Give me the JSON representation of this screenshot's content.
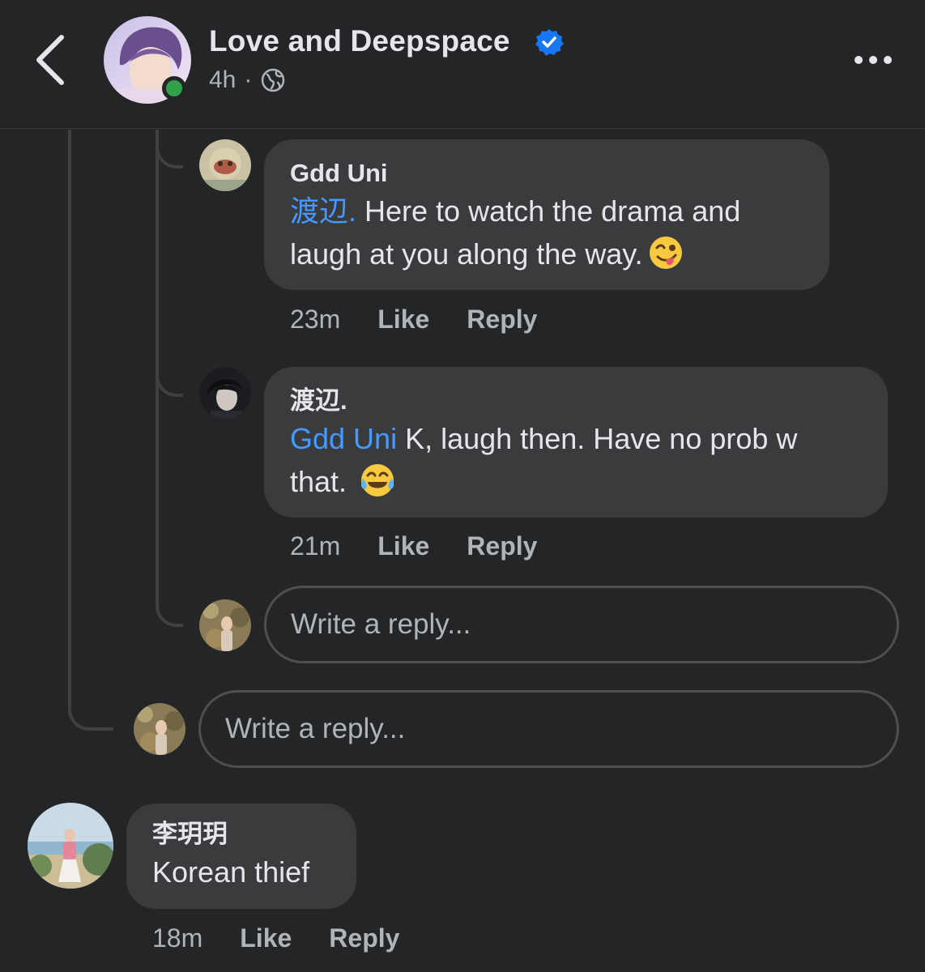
{
  "header": {
    "page_name": "Love and Deepspace",
    "time": "4h",
    "separator": "·",
    "verified": true,
    "icons": [
      "back-arrow-icon",
      "verified-badge-icon",
      "globe-icon",
      "more-icon"
    ]
  },
  "comments": [
    {
      "author": "Gdd Uni",
      "mention": "渡辺.",
      "text": " Here to watch the drama and laugh at you along the way.",
      "emoji": "winking-face-with-tongue",
      "time": "23m",
      "like": "Like",
      "reply": "Reply"
    },
    {
      "author": "渡辺.",
      "mention": "Gdd Uni",
      "text": " K, laugh then. Have no prob w that. ",
      "emoji": "face-with-tears-of-joy",
      "time": "21m",
      "like": "Like",
      "reply": "Reply"
    },
    {
      "author": "李玥玥",
      "text": "Korean thief",
      "time": "18m",
      "like": "Like",
      "reply": "Reply"
    }
  ],
  "reply_boxes": {
    "nested_placeholder": "Write a reply...",
    "outer_placeholder": "Write a reply..."
  },
  "colors": {
    "background": "#242526",
    "bubble": "#3a3b3c",
    "mention": "#4599ff",
    "online": "#31a24c",
    "verified": "#1877f2"
  }
}
